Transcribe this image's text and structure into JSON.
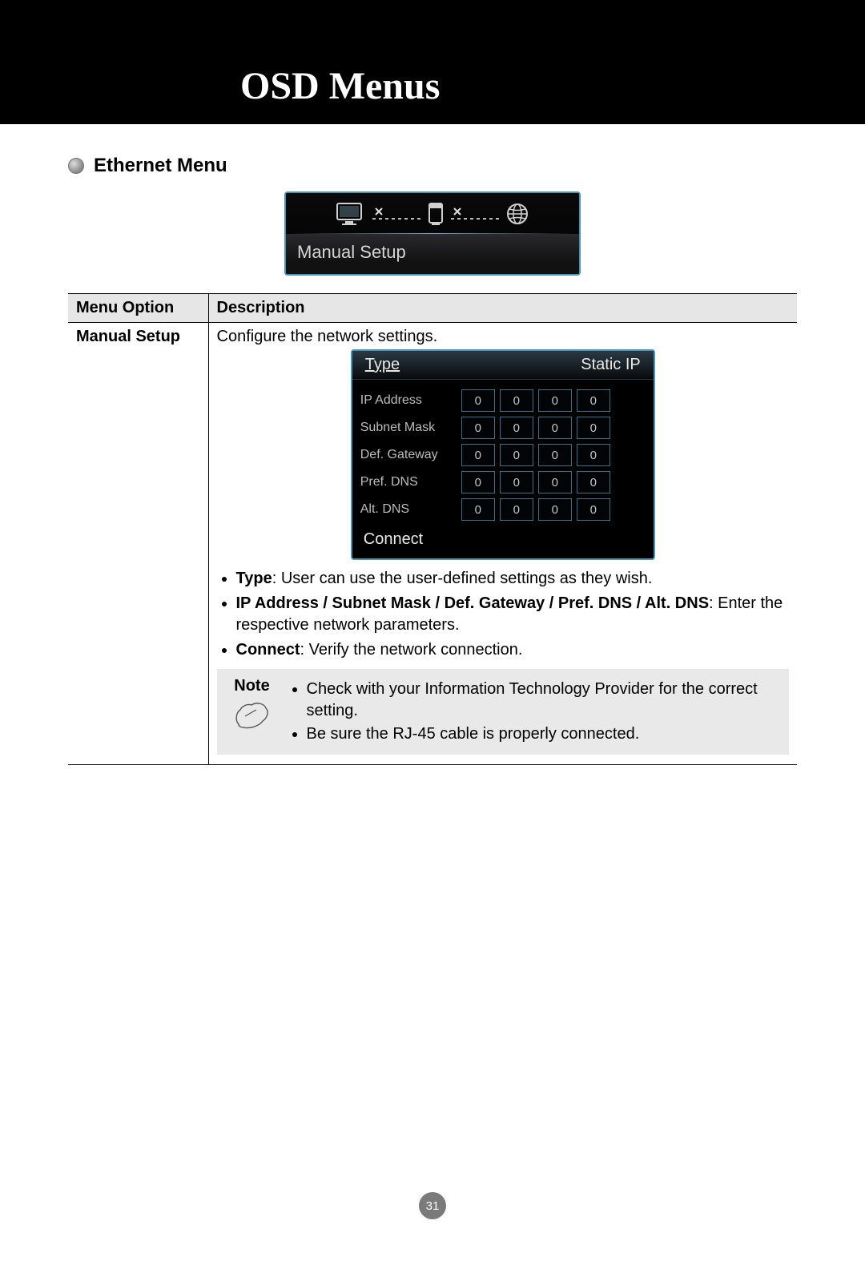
{
  "header": {
    "title": "OSD Menus"
  },
  "section": {
    "title": "Ethernet Menu"
  },
  "osd1": {
    "label": "Manual Setup"
  },
  "table": {
    "headers": {
      "option": "Menu Option",
      "description": "Description"
    },
    "row": {
      "option": "Manual Setup",
      "intro": "Configure the network settings."
    }
  },
  "osd_ip": {
    "header_left": "Type",
    "header_right": "Static IP",
    "rows": [
      {
        "label": "IP Address",
        "cells": [
          "0",
          "0",
          "0",
          "0"
        ]
      },
      {
        "label": "Subnet Mask",
        "cells": [
          "0",
          "0",
          "0",
          "0"
        ]
      },
      {
        "label": "Def. Gateway",
        "cells": [
          "0",
          "0",
          "0",
          "0"
        ]
      },
      {
        "label": "Pref. DNS",
        "cells": [
          "0",
          "0",
          "0",
          "0"
        ]
      },
      {
        "label": "Alt. DNS",
        "cells": [
          "0",
          "0",
          "0",
          "0"
        ]
      }
    ],
    "footer": "Connect"
  },
  "bullets": {
    "b1_bold": "Type",
    "b1_rest": ": User can use the user-defined settings as they wish.",
    "b2_bold": "IP Address / Subnet Mask / Def. Gateway / Pref. DNS / Alt. DNS",
    "b2_rest": ": Enter the respective network parameters.",
    "b3_bold": "Connect",
    "b3_rest": ": Verify the network connection."
  },
  "note": {
    "label": "Note",
    "items": [
      "Check with your Information Technology Provider for the correct setting.",
      "Be sure the RJ-45 cable is properly connected."
    ]
  },
  "page_number": "31"
}
